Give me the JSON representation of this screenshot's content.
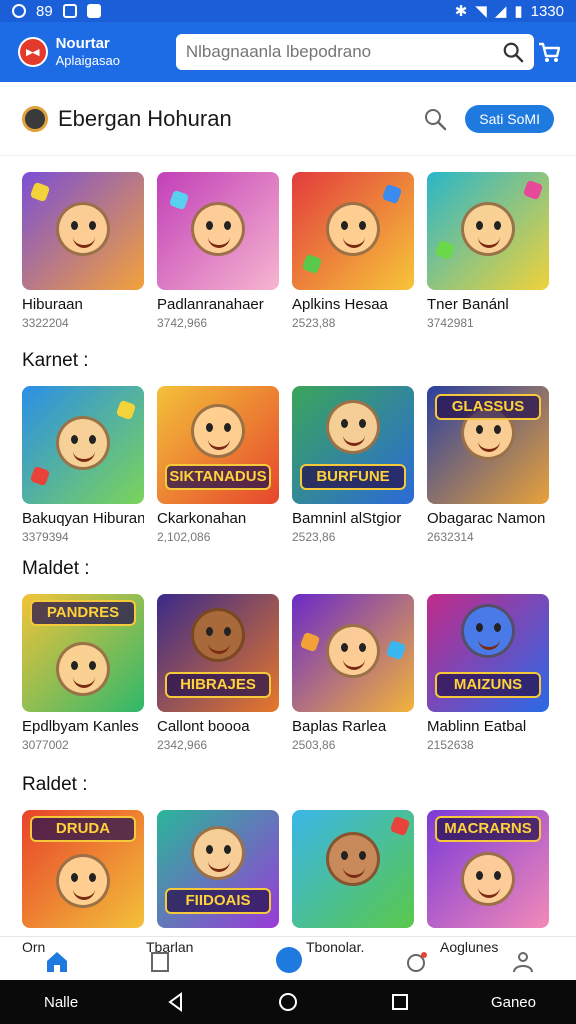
{
  "status_bar": {
    "time": "1330",
    "left_text": "89"
  },
  "app": {
    "name_line1": "Nourtar",
    "name_line2": "Aplaigasao",
    "search_placeholder": "Nlbagnaanla lbepodrano"
  },
  "header": {
    "title": "Ebergan Hohuran",
    "button_label": "Sati SoMI"
  },
  "sections": [
    {
      "title": "",
      "apps": [
        {
          "name": "Hiburaan",
          "count": "3322204",
          "color1": "#7a4fd6",
          "color2": "#f3a23a"
        },
        {
          "name": "Padlanranahaer",
          "count": "3742,966",
          "color1": "#c23fb8",
          "color2": "#f6b6cf"
        },
        {
          "name": "Aplkins Hesaa",
          "count": "2523,88",
          "color1": "#e23c3c",
          "color2": "#f7c53a"
        },
        {
          "name": "Tner Banánl",
          "count": "3742981",
          "color1": "#2ab6c9",
          "color2": "#f0d23a"
        }
      ]
    },
    {
      "title": "Karnet :",
      "apps": [
        {
          "name": "Bakuqyan Hiburan",
          "count": "3379394",
          "color1": "#2b8fe6",
          "color2": "#7bd45a"
        },
        {
          "name": "Ckarkonahan",
          "count": "2,102,086",
          "color1": "#f3c13a",
          "color2": "#e6462c",
          "banner": "SIKTANADUS"
        },
        {
          "name": "Bamninl alStgior",
          "count": "2523,86",
          "color1": "#3aa65a",
          "color2": "#2b6ad8",
          "banner": "BURFUNE"
        },
        {
          "name": "Obagarac Namon",
          "count": "2632314",
          "color1": "#2a3fa0",
          "color2": "#e8a23a",
          "banner": "GLASSUS"
        }
      ]
    },
    {
      "title": "Maldet :",
      "apps": [
        {
          "name": "Epdlbyam Kanles",
          "count": "3077002",
          "color1": "#f3c33a",
          "color2": "#2fb86a",
          "banner": "PANDRES"
        },
        {
          "name": "Callont boooa",
          "count": "2342,966",
          "color1": "#3a2a8a",
          "color2": "#e8782a",
          "banner": "HIBRAJES"
        },
        {
          "name": "Baplas Rarlea",
          "count": "2503,86",
          "color1": "#6a2ac8",
          "color2": "#f3b33a"
        },
        {
          "name": "Mablinn Eatbal",
          "count": "2152638",
          "color1": "#c22a8a",
          "color2": "#2a6ae8",
          "banner": "MAIZUNS"
        }
      ]
    },
    {
      "title": "Raldet :",
      "apps": [
        {
          "name": "",
          "count": "",
          "color1": "#e8422a",
          "color2": "#f3c13a",
          "banner": "DRUDA"
        },
        {
          "name": "",
          "count": "",
          "color1": "#2ab69a",
          "color2": "#9a3ad8",
          "banner": "FIIDOAIS"
        },
        {
          "name": "",
          "count": "",
          "color1": "#3ab6e8",
          "color2": "#5ac84a"
        },
        {
          "name": "",
          "count": "",
          "color1": "#7a3ad8",
          "color2": "#f38ab8",
          "banner": "MACRARNS"
        }
      ]
    }
  ],
  "bottom_nav": {
    "item1": "Orn",
    "item2": "Tbarlan",
    "item3": "Tbonolar.",
    "item4": "Aoglunes"
  },
  "system_nav": {
    "left": "Nalle",
    "right": "Ganeo"
  },
  "colors": {
    "primary": "#1e6be6",
    "accent": "#1f7ae0"
  }
}
